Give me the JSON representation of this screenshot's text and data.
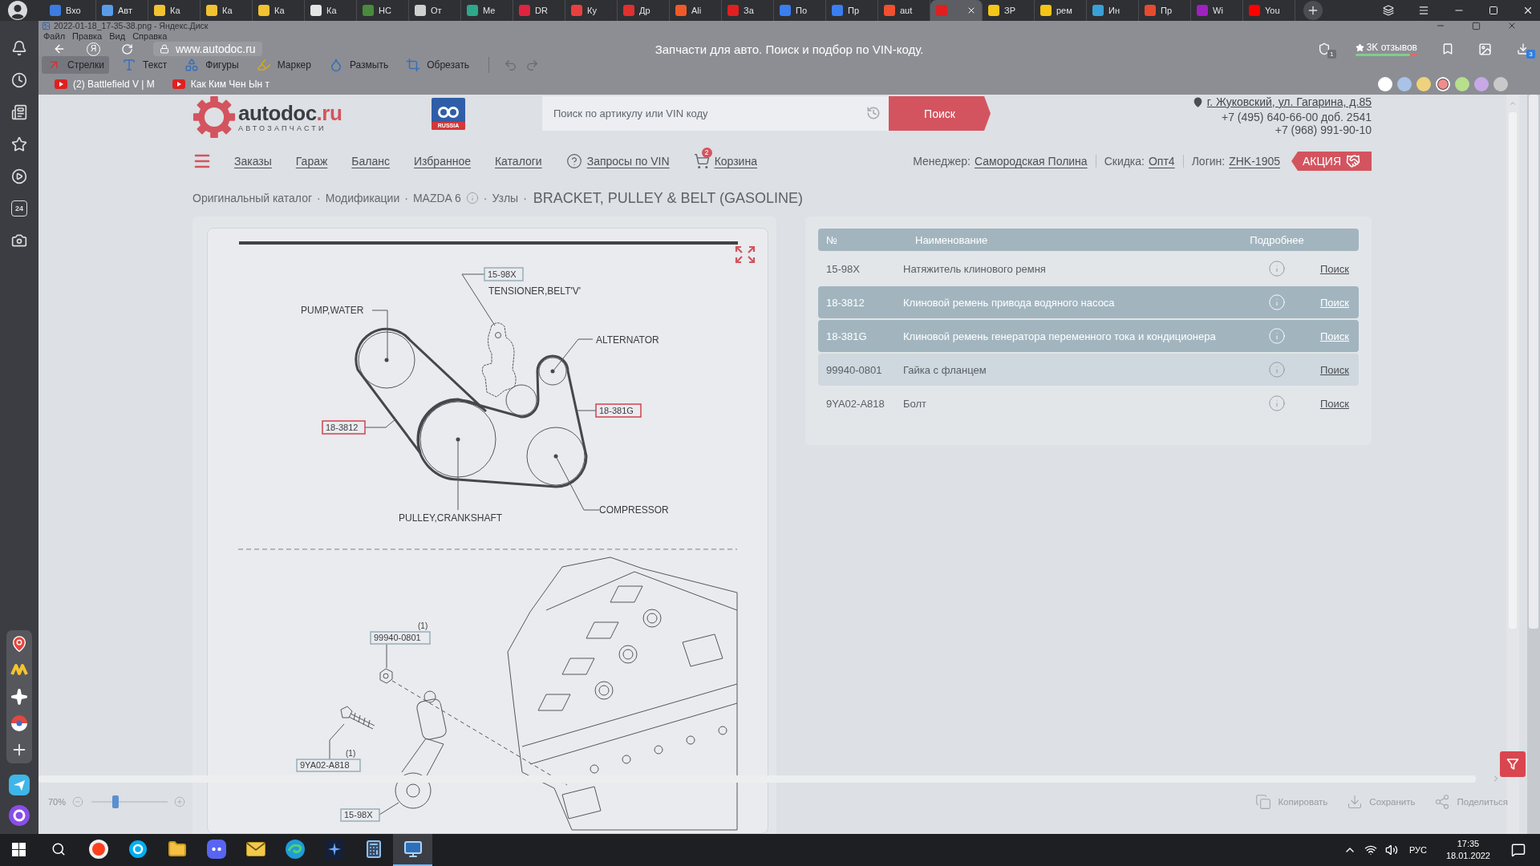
{
  "browser": {
    "tabs": [
      {
        "label": "Вхо",
        "color": "#3d7be0",
        "selected": false
      },
      {
        "label": "Авт",
        "color": "#5a9be8",
        "selected": false
      },
      {
        "label": "Ка",
        "color": "#f2c230",
        "selected": false
      },
      {
        "label": "Ка",
        "color": "#f2c230",
        "selected": false
      },
      {
        "label": "Ка",
        "color": "#f2c230",
        "selected": false
      },
      {
        "label": "Ка",
        "color": "#e4e4e4",
        "selected": false
      },
      {
        "label": "НС",
        "color": "#4a8a3c",
        "selected": false
      },
      {
        "label": "От",
        "color": "#cfcfcf",
        "selected": false
      },
      {
        "label": "Ме",
        "color": "#2ea88a",
        "selected": false
      },
      {
        "label": "DR",
        "color": "#e02440",
        "selected": false
      },
      {
        "label": "Ку",
        "color": "#e84040",
        "selected": false
      },
      {
        "label": "Др",
        "color": "#e03030",
        "selected": false
      },
      {
        "label": "Ali",
        "color": "#f05a28",
        "selected": false
      },
      {
        "label": "За",
        "color": "#e02020",
        "selected": false
      },
      {
        "label": "По",
        "color": "#3a7ef0",
        "selected": false
      },
      {
        "label": "Пр",
        "color": "#3a7ef0",
        "selected": false
      },
      {
        "label": "aut",
        "color": "#f05030",
        "selected": false
      },
      {
        "color": "#e02020",
        "selected": true
      },
      {
        "label": "ЗР",
        "color": "#f5c518",
        "selected": false
      },
      {
        "label": "рем",
        "color": "#f5c518",
        "selected": false
      },
      {
        "label": "Ин",
        "color": "#3aa0d8",
        "selected": false
      },
      {
        "label": "Пр",
        "color": "#e84a30",
        "selected": false
      },
      {
        "label": "Wi",
        "color": "#a020c0",
        "selected": false
      },
      {
        "label": "You",
        "color": "#ff0000",
        "selected": false
      }
    ],
    "home_label": "Я",
    "address": "www.autodoc.ru",
    "page_title": "Запчасти для авто. Поиск и подбор по VIN-коду.",
    "shield_count": "1",
    "reviews": {
      "label": "3K отзывов",
      "level": 0.88
    },
    "downloads_count": "3",
    "bookmarks": [
      {
        "label": "(2) Battlefield V | M"
      },
      {
        "label": "Как Ким Чен Ын т"
      }
    ]
  },
  "editor": {
    "title": "2022-01-18_17-35-38.png - Яндекс.Диск",
    "menu": [
      "Файл",
      "Правка",
      "Вид",
      "Справка"
    ],
    "tools": [
      {
        "kind": "arrow",
        "label": "Стрелки",
        "selected": true
      },
      {
        "kind": "text",
        "label": "Текст",
        "selected": false
      },
      {
        "kind": "shapes",
        "label": "Фигуры",
        "selected": false
      },
      {
        "kind": "marker",
        "label": "Маркер",
        "selected": false
      },
      {
        "kind": "blur",
        "label": "Размыть",
        "selected": false
      },
      {
        "kind": "crop",
        "label": "Обрезать",
        "selected": false
      }
    ],
    "palette": [
      {
        "color": "#ffffff",
        "selected": false
      },
      {
        "color": "#a9c3e8",
        "selected": false
      },
      {
        "color": "#efd27c",
        "selected": false
      },
      {
        "color": "#ef8d8d",
        "selected": true
      },
      {
        "color": "#b7df8c",
        "selected": false
      },
      {
        "color": "#c7a9e6",
        "selected": false
      },
      {
        "color": "#c9c9c9",
        "selected": false
      }
    ],
    "zoom": {
      "label": "70%",
      "level": 0.32
    },
    "actions": [
      {
        "kind": "copy",
        "label": "Копировать"
      },
      {
        "kind": "save",
        "label": "Сохранить"
      },
      {
        "kind": "share",
        "label": "Поделиться"
      }
    ]
  },
  "sidebar": {
    "items": [
      {
        "kind": "bell"
      },
      {
        "kind": "history"
      },
      {
        "kind": "feed"
      },
      {
        "kind": "favorites"
      },
      {
        "kind": "video"
      },
      {
        "kind": "calendar",
        "label": "24"
      },
      {
        "kind": "screenshot"
      }
    ],
    "apps": [
      {
        "kind": "maps"
      },
      {
        "kind": "market"
      },
      {
        "kind": "sparkle"
      },
      {
        "kind": "ball"
      },
      {
        "kind": "add"
      }
    ],
    "extras": [
      {
        "kind": "messenger"
      },
      {
        "kind": "alice"
      }
    ]
  },
  "site": {
    "logo": {
      "name": "autodoc",
      "domain": ".ru",
      "tagline": "АВТОЗАПЧАСТИ"
    },
    "badge": "RUSSIA",
    "search": {
      "placeholder": "Поиск по артикулу или VIN коду",
      "button": "Поиск"
    },
    "address": "г. Жуковский, ул. Гагарина, д.85",
    "phones": [
      "+7 (495) 640-66-00 доб. 2541",
      "+7 (968) 991-90-10"
    ],
    "nav": [
      {
        "kind": "link",
        "label": "Заказы"
      },
      {
        "kind": "link",
        "label": "Гараж"
      },
      {
        "kind": "link",
        "label": "Баланс"
      },
      {
        "kind": "link",
        "label": "Избранное"
      },
      {
        "kind": "link",
        "label": "Каталоги"
      },
      {
        "kind": "help",
        "label": "Запросы по VIN"
      },
      {
        "kind": "cart",
        "label": "Корзина",
        "count": "2"
      }
    ],
    "account": [
      {
        "label": "Менеджер:",
        "value": "Самородская Полина"
      },
      {
        "label": "Скидка:",
        "value": "Опт4"
      },
      {
        "label": "Логин:",
        "value": "ZHK-1905"
      }
    ],
    "promo": "АКЦИЯ",
    "breadcrumbs": [
      {
        "kind": "link",
        "text": "Оригинальный каталог"
      },
      {
        "kind": "separator",
        "text": "·"
      },
      {
        "kind": "link",
        "text": "Модификации"
      },
      {
        "kind": "separator",
        "text": "·"
      },
      {
        "kind": "link",
        "text": "MAZDA 6"
      },
      {
        "kind": "info"
      },
      {
        "kind": "separator",
        "text": "·"
      },
      {
        "kind": "link",
        "text": "Узлы"
      },
      {
        "kind": "separator",
        "text": "·"
      },
      {
        "kind": "current",
        "text": "BRACKET, PULLEY & BELT (GASOLINE)"
      }
    ],
    "diagram": {
      "labels": [
        "PUMP,WATER",
        "TENSIONER,BELT'V'",
        "ALTERNATOR",
        "PULLEY,CRANKSHAFT",
        "COMPRESSOR"
      ],
      "callouts": [
        {
          "number": "15-98X",
          "selected": false
        },
        {
          "number": "18-3812",
          "selected": true
        },
        {
          "number": "18-381G",
          "selected": true
        },
        {
          "number": "99940-0801",
          "note": "(1)",
          "selected": false
        },
        {
          "number": "9YA02-A818",
          "note": "(1)",
          "selected": false
        },
        {
          "number": "15-98X",
          "selected": false
        }
      ]
    },
    "table": {
      "columns": [
        "№",
        "Наименование",
        "Подробнее"
      ],
      "rows": [
        {
          "number": "15-98X",
          "name": "Натяжитель клинового ремня",
          "link": "Поиск",
          "selected": false,
          "hovered": false
        },
        {
          "number": "18-3812",
          "name": "Клиновой ремень привода водяного насоса",
          "link": "Поиск",
          "selected": true,
          "hovered": false
        },
        {
          "number": "18-381G",
          "name": "Клиновой ремень генератора переменного тока и кондиционера",
          "link": "Поиск",
          "selected": true,
          "hovered": false
        },
        {
          "number": "99940-0801",
          "name": "Гайка с фланцем",
          "link": "Поиск",
          "selected": false,
          "hovered": true
        },
        {
          "number": "9YA02-A818",
          "name": "Болт",
          "link": "Поиск",
          "selected": false,
          "hovered": false
        }
      ]
    }
  },
  "taskbar": {
    "apps": [
      {
        "kind": "yandex",
        "selected": false
      },
      {
        "kind": "skype",
        "selected": false
      },
      {
        "kind": "explorer",
        "selected": false
      },
      {
        "kind": "discord",
        "selected": false
      },
      {
        "kind": "mail",
        "selected": false
      },
      {
        "kind": "edge",
        "selected": false
      },
      {
        "kind": "terminal",
        "selected": false
      },
      {
        "kind": "calculator",
        "selected": false
      },
      {
        "kind": "screenshot",
        "selected": true
      }
    ],
    "language": "РУС",
    "time": "17:35",
    "date": "18.01.2022"
  }
}
